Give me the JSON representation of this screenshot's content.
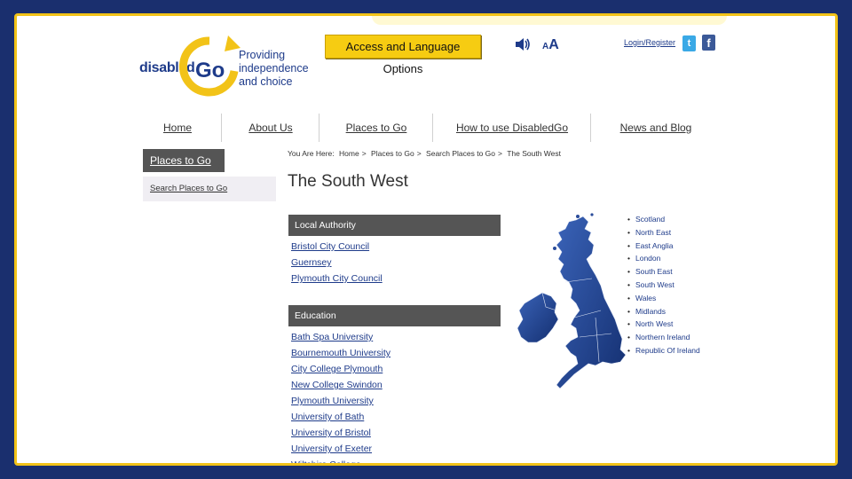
{
  "logo": {
    "wordmark": "disabled",
    "go": "Go",
    "tagline": [
      "Providing",
      "independence",
      "and choice"
    ]
  },
  "header": {
    "access_button": "Access and Language Options",
    "text_size_small": "A",
    "text_size_big": "A",
    "login": "Login/Register"
  },
  "nav": {
    "items": [
      "Home",
      "About Us",
      "Places to Go",
      "How to use DisabledGo",
      "News and Blog"
    ]
  },
  "sidebar": {
    "heading": "Places to Go",
    "item": "Search Places to Go"
  },
  "breadcrumb": {
    "prefix": "You Are Here:",
    "items": [
      "Home",
      "Places to Go",
      "Search Places to Go",
      "The South West"
    ]
  },
  "page": {
    "title": "The South West"
  },
  "sections": [
    {
      "heading": "Local Authority",
      "links": [
        "Bristol City Council",
        "Guernsey",
        "Plymouth City Council"
      ]
    },
    {
      "heading": "Education",
      "links": [
        "Bath Spa University",
        "Bournemouth University",
        "City College Plymouth",
        "New College Swindon",
        "Plymouth University",
        "University of Bath",
        "University of Bristol",
        "University of Exeter",
        "Wiltshire College"
      ]
    }
  ],
  "regions": [
    "Scotland",
    "North East",
    "East Anglia",
    "London",
    "South East",
    "South West",
    "Wales",
    "Midlands",
    "North West",
    "Northern Ireland",
    "Republic Of Ireland"
  ],
  "colors": {
    "brand_blue": "#1e3b8a",
    "brand_yellow": "#f2c318",
    "section_grey": "#555555",
    "frame_navy": "#1a2f6e"
  }
}
